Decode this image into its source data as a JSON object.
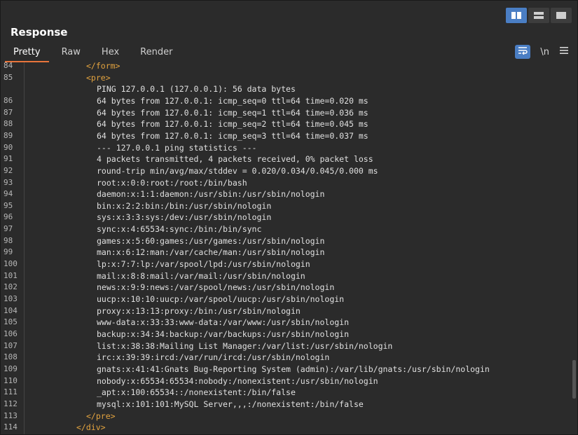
{
  "header": {
    "title": "Response"
  },
  "tabs": [
    {
      "label": "Pretty"
    },
    {
      "label": "Raw"
    },
    {
      "label": "Hex"
    },
    {
      "label": "Render"
    }
  ],
  "tools": {
    "newline_label": "\\n"
  },
  "lines": [
    {
      "num": "84",
      "text": "</form>",
      "indent": 1,
      "kind": "tag"
    },
    {
      "num": "85",
      "text": "<pre>",
      "indent": 1,
      "kind": "tag"
    },
    {
      "num": "",
      "text": "PING 127.0.0.1 (127.0.0.1): 56 data bytes",
      "indent": 2,
      "kind": "text"
    },
    {
      "num": "86",
      "text": "64 bytes from 127.0.0.1: icmp_seq=0 ttl=64 time=0.020 ms",
      "indent": 2,
      "kind": "text"
    },
    {
      "num": "87",
      "text": "64 bytes from 127.0.0.1: icmp_seq=1 ttl=64 time=0.036 ms",
      "indent": 2,
      "kind": "text"
    },
    {
      "num": "88",
      "text": "64 bytes from 127.0.0.1: icmp_seq=2 ttl=64 time=0.045 ms",
      "indent": 2,
      "kind": "text"
    },
    {
      "num": "89",
      "text": "64 bytes from 127.0.0.1: icmp_seq=3 ttl=64 time=0.037 ms",
      "indent": 2,
      "kind": "text"
    },
    {
      "num": "90",
      "text": "--- 127.0.0.1 ping statistics ---",
      "indent": 2,
      "kind": "text"
    },
    {
      "num": "91",
      "text": "4 packets transmitted, 4 packets received, 0% packet loss",
      "indent": 2,
      "kind": "text"
    },
    {
      "num": "92",
      "text": "round-trip min/avg/max/stddev = 0.020/0.034/0.045/0.000 ms",
      "indent": 2,
      "kind": "text"
    },
    {
      "num": "93",
      "text": "root:x:0:0:root:/root:/bin/bash",
      "indent": 2,
      "kind": "text"
    },
    {
      "num": "94",
      "text": "daemon:x:1:1:daemon:/usr/sbin:/usr/sbin/nologin",
      "indent": 2,
      "kind": "text"
    },
    {
      "num": "95",
      "text": "bin:x:2:2:bin:/bin:/usr/sbin/nologin",
      "indent": 2,
      "kind": "text"
    },
    {
      "num": "96",
      "text": "sys:x:3:3:sys:/dev:/usr/sbin/nologin",
      "indent": 2,
      "kind": "text"
    },
    {
      "num": "97",
      "text": "sync:x:4:65534:sync:/bin:/bin/sync",
      "indent": 2,
      "kind": "text"
    },
    {
      "num": "98",
      "text": "games:x:5:60:games:/usr/games:/usr/sbin/nologin",
      "indent": 2,
      "kind": "text"
    },
    {
      "num": "99",
      "text": "man:x:6:12:man:/var/cache/man:/usr/sbin/nologin",
      "indent": 2,
      "kind": "text"
    },
    {
      "num": "100",
      "text": "lp:x:7:7:lp:/var/spool/lpd:/usr/sbin/nologin",
      "indent": 2,
      "kind": "text"
    },
    {
      "num": "101",
      "text": "mail:x:8:8:mail:/var/mail:/usr/sbin/nologin",
      "indent": 2,
      "kind": "text"
    },
    {
      "num": "102",
      "text": "news:x:9:9:news:/var/spool/news:/usr/sbin/nologin",
      "indent": 2,
      "kind": "text"
    },
    {
      "num": "103",
      "text": "uucp:x:10:10:uucp:/var/spool/uucp:/usr/sbin/nologin",
      "indent": 2,
      "kind": "text"
    },
    {
      "num": "104",
      "text": "proxy:x:13:13:proxy:/bin:/usr/sbin/nologin",
      "indent": 2,
      "kind": "text"
    },
    {
      "num": "105",
      "text": "www-data:x:33:33:www-data:/var/www:/usr/sbin/nologin",
      "indent": 2,
      "kind": "text"
    },
    {
      "num": "106",
      "text": "backup:x:34:34:backup:/var/backups:/usr/sbin/nologin",
      "indent": 2,
      "kind": "text"
    },
    {
      "num": "107",
      "text": "list:x:38:38:Mailing List Manager:/var/list:/usr/sbin/nologin",
      "indent": 2,
      "kind": "text"
    },
    {
      "num": "108",
      "text": "irc:x:39:39:ircd:/var/run/ircd:/usr/sbin/nologin",
      "indent": 2,
      "kind": "text"
    },
    {
      "num": "109",
      "text": "gnats:x:41:41:Gnats Bug-Reporting System (admin):/var/lib/gnats:/usr/sbin/nologin",
      "indent": 2,
      "kind": "text"
    },
    {
      "num": "110",
      "text": "nobody:x:65534:65534:nobody:/nonexistent:/usr/sbin/nologin",
      "indent": 2,
      "kind": "text"
    },
    {
      "num": "111",
      "text": "_apt:x:100:65534::/nonexistent:/bin/false",
      "indent": 2,
      "kind": "text"
    },
    {
      "num": "112",
      "text": "mysql:x:101:101:MySQL Server,,,:/nonexistent:/bin/false",
      "indent": 2,
      "kind": "text"
    },
    {
      "num": "113",
      "text": "</pre>",
      "indent": 1,
      "kind": "tag"
    },
    {
      "num": "114",
      "text": "</div>",
      "indent": 0,
      "kind": "tag"
    }
  ]
}
